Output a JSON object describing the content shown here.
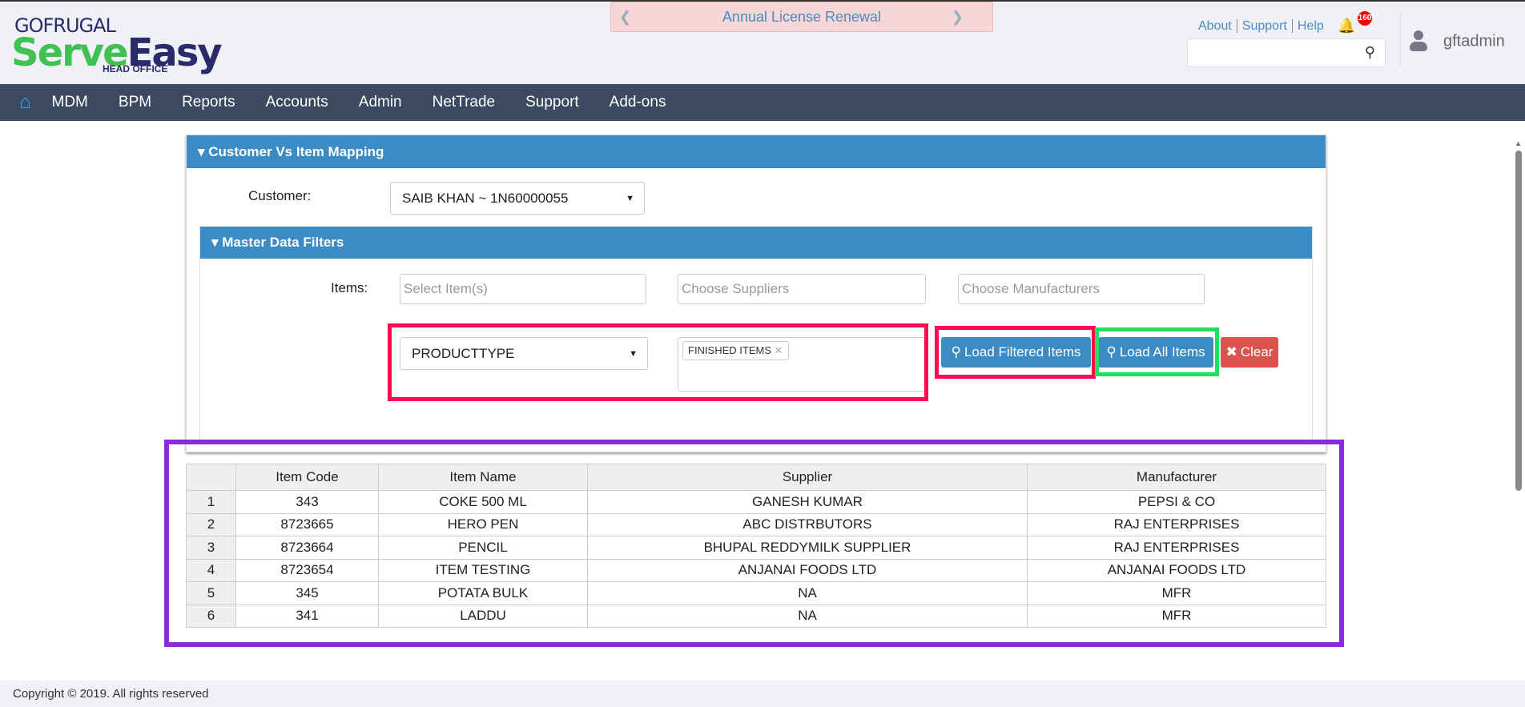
{
  "logo": {
    "brand": "GOFRUGAL",
    "product_a": "Serve",
    "product_b": "Easy",
    "edition": "HEAD OFFICE"
  },
  "banner": {
    "text": "Annual License Renewal"
  },
  "toplinks": [
    "About",
    "Support",
    "Help"
  ],
  "notifications": {
    "count": "160"
  },
  "search": {
    "value": ""
  },
  "user": {
    "name": "gftadmin"
  },
  "nav": [
    "MDM",
    "BPM",
    "Reports",
    "Accounts",
    "Admin",
    "NetTrade",
    "Support",
    "Add-ons"
  ],
  "panel": {
    "title": "Customer Vs Item Mapping",
    "customer_label": "Customer:",
    "customer_value": "SAIB KHAN ~ 1N60000055"
  },
  "filters": {
    "title": "Master Data Filters",
    "items_label": "Items:",
    "items_placeholder": "Select Item(s)",
    "suppliers_placeholder": "Choose Suppliers",
    "manufacturers_placeholder": "Choose Manufacturers",
    "attribute_value": "PRODUCTTYPE",
    "tag": "FINISHED ITEMS",
    "load_filtered": "Load Filtered Items",
    "load_all": "Load All Items",
    "clear": "Clear"
  },
  "table": {
    "headers": [
      "",
      "Item Code",
      "Item Name",
      "Supplier",
      "Manufacturer"
    ],
    "rows": [
      [
        "1",
        "343",
        "COKE 500 ML",
        "GANESH KUMAR",
        "PEPSI & CO"
      ],
      [
        "2",
        "8723665",
        "HERO PEN",
        "ABC DISTRBUTORS",
        "RAJ ENTERPRISES"
      ],
      [
        "3",
        "8723664",
        "PENCIL",
        "BHUPAL REDDYMILK SUPPLIER",
        "RAJ ENTERPRISES"
      ],
      [
        "4",
        "8723654",
        "ITEM TESTING",
        "ANJANAI FOODS LTD",
        "ANJANAI FOODS LTD"
      ],
      [
        "5",
        "345",
        "POTATA BULK",
        "NA",
        "MFR"
      ],
      [
        "6",
        "341",
        "LADDU",
        "NA",
        "MFR"
      ]
    ]
  },
  "footer": {
    "text": "Copyright © 2019. All rights reserved"
  }
}
